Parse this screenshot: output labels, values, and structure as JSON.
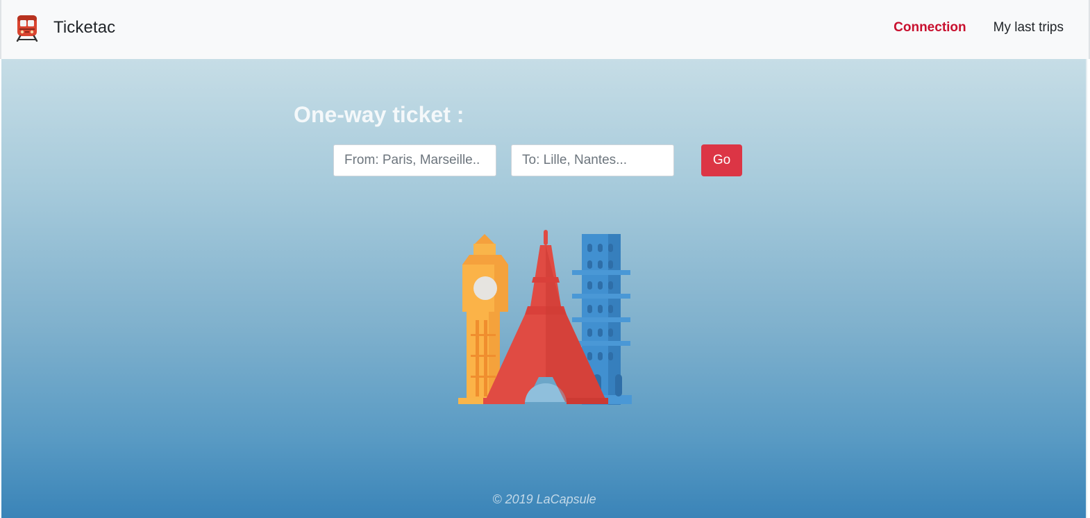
{
  "header": {
    "brand": {
      "label": "Ticketac",
      "icon": "train-icon"
    },
    "nav": [
      {
        "label": "Connection",
        "active": true,
        "color": "#c8102e"
      },
      {
        "label": "My last trips",
        "active": false
      }
    ]
  },
  "search": {
    "title": "One-way ticket :",
    "from_placeholder": "From: Paris, Marseille..",
    "to_placeholder": "To: Lille, Nantes...",
    "go_label": "Go"
  },
  "illustration": {
    "icon": "landmarks-illustration",
    "landmarks": [
      "big-ben-icon",
      "eiffel-tower-icon",
      "leaning-tower-icon"
    ]
  },
  "footer": {
    "text": "© 2019 LaCapsule"
  },
  "colors": {
    "accent": "#dc3545",
    "nav_active": "#c8102e",
    "navbar_bg": "#f8f9fa",
    "hero_top": "#c6dde6",
    "hero_bottom": "#3a84b8"
  }
}
